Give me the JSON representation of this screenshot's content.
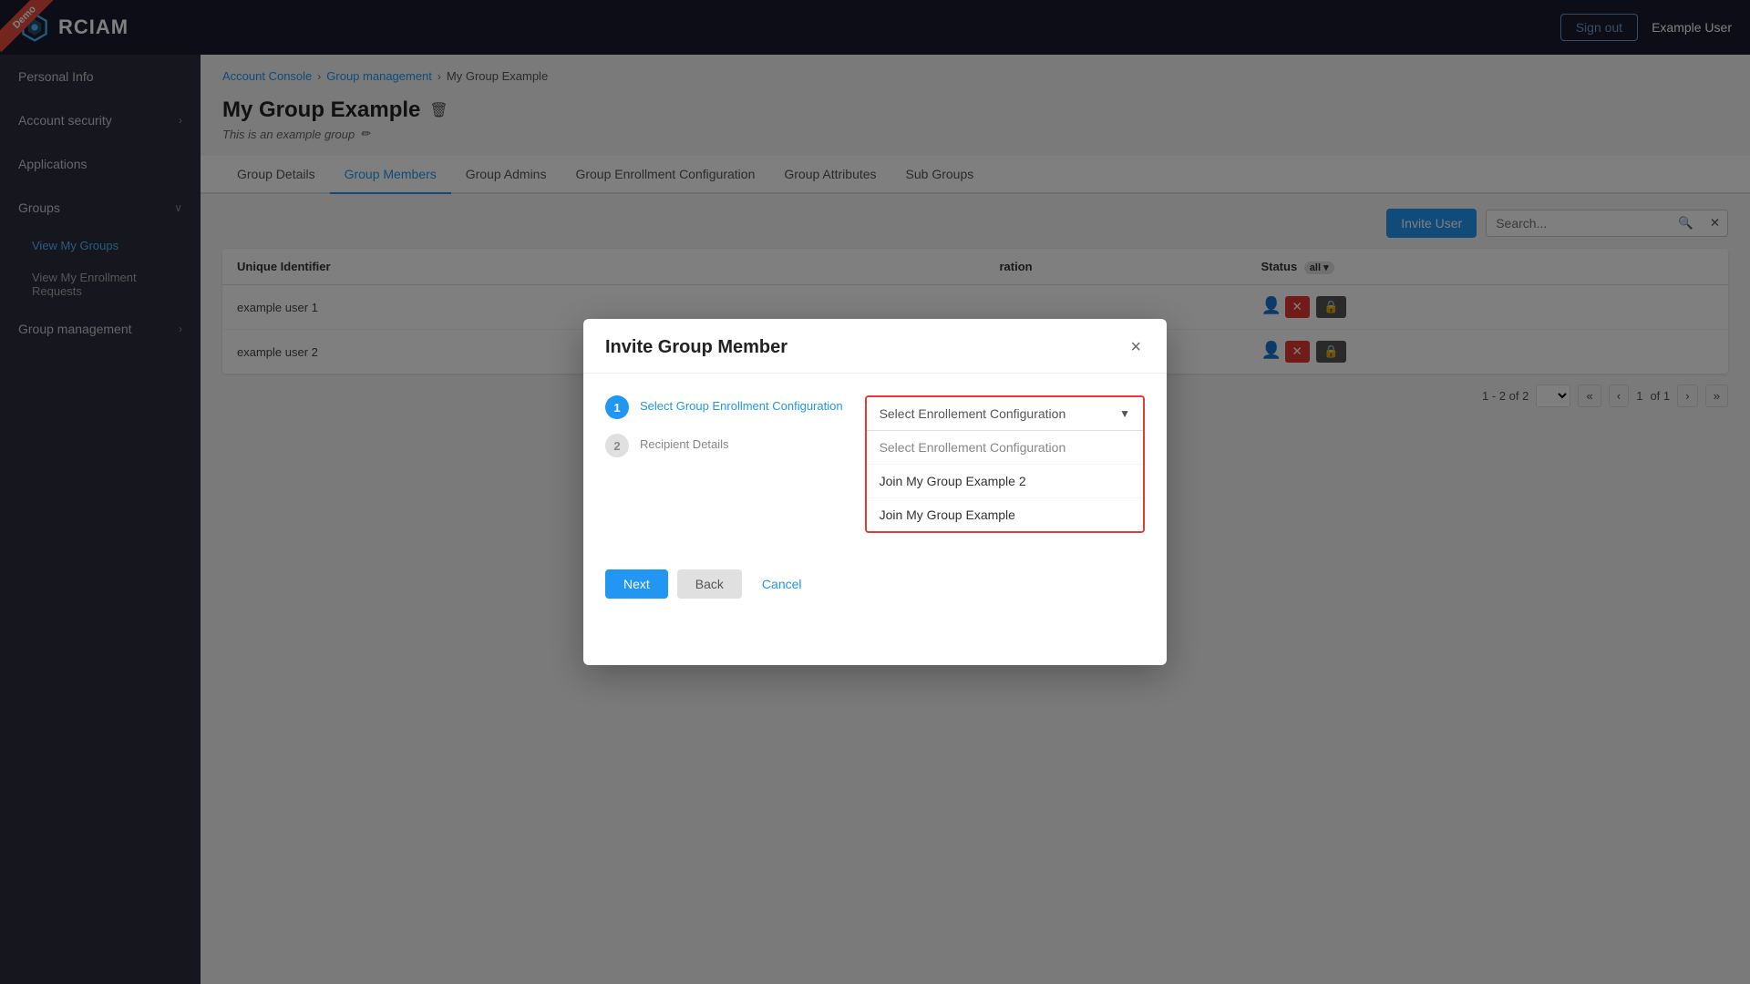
{
  "header": {
    "logo_text": "RCIAM",
    "sign_out_label": "Sign out",
    "user_name": "Example User",
    "demo_label": "Demo"
  },
  "sidebar": {
    "personal_info": "Personal Info",
    "account_security": "Account security",
    "applications": "Applications",
    "groups": "Groups",
    "view_my_groups": "View My Groups",
    "view_enrollment_requests": "View My Enrollment Requests",
    "group_management": "Group management"
  },
  "breadcrumb": {
    "account_console": "Account Console",
    "group_management": "Group management",
    "current": "My Group Example"
  },
  "page": {
    "title": "My Group Example",
    "subtitle": "This is an example group"
  },
  "tabs": [
    "Group Details",
    "Group Members",
    "Group Admins",
    "Group Enrollment Configuration",
    "Group Attributes",
    "Sub Groups"
  ],
  "active_tab": "Group Members",
  "toolbar": {
    "invite_label": "Invite User",
    "search_placeholder": "Search..."
  },
  "table": {
    "columns": [
      "Unique Identifier",
      "",
      "",
      "ration",
      "Status"
    ],
    "rows": [
      {
        "identifier": "example user 1"
      },
      {
        "identifier": "example user 2"
      }
    ],
    "pagination": {
      "summary": "1 - 2 of 2",
      "page": "1",
      "of": "of 1",
      "all_label": "all"
    }
  },
  "modal": {
    "title": "Invite Group Member",
    "steps": [
      {
        "number": "1",
        "label": "Select Group Enrollment Configuration",
        "active": true
      },
      {
        "number": "2",
        "label": "Recipient Details",
        "active": false
      }
    ],
    "dropdown": {
      "placeholder": "Select Enrollement Configuration",
      "options": [
        "Select Enrollement Configuration",
        "Join My Group Example 2",
        "Join My Group Example"
      ]
    },
    "buttons": {
      "next": "Next",
      "back": "Back",
      "cancel": "Cancel"
    }
  }
}
